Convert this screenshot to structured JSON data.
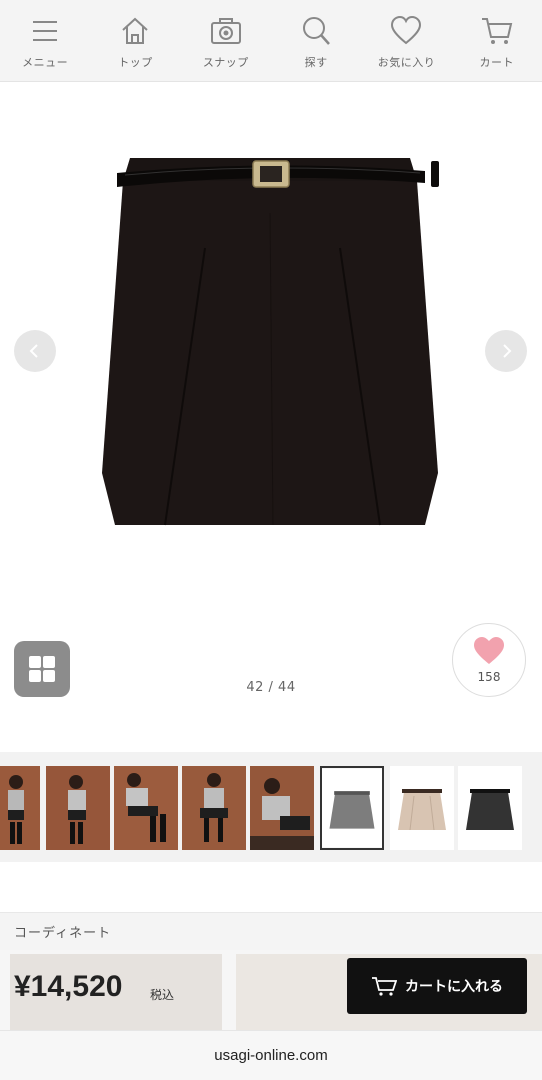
{
  "nav": {
    "items": [
      {
        "label": "メニュー",
        "icon": "hamburger-menu-icon"
      },
      {
        "label": "トップ",
        "icon": "home-icon"
      },
      {
        "label": "スナップ",
        "icon": "camera-icon"
      },
      {
        "label": "探す",
        "icon": "search-icon"
      },
      {
        "label": "お気に入り",
        "icon": "heart-icon"
      },
      {
        "label": "カート",
        "icon": "cart-icon"
      }
    ]
  },
  "gallery": {
    "counter": "42 / 44",
    "favorite_count": "158",
    "favorite_color": "#f2a2ae"
  },
  "thumbnails": {
    "count": 8,
    "selected_index": 4,
    "product_colors": [
      "#7d7d7d",
      "#d8c4b2",
      "#333333"
    ]
  },
  "coordinate": {
    "title": "コーディネート"
  },
  "purchase": {
    "price": "¥14,520",
    "tax_label": "税込",
    "cart_button_label": "カートに入れる"
  },
  "browser": {
    "url": "usagi-online.com"
  }
}
